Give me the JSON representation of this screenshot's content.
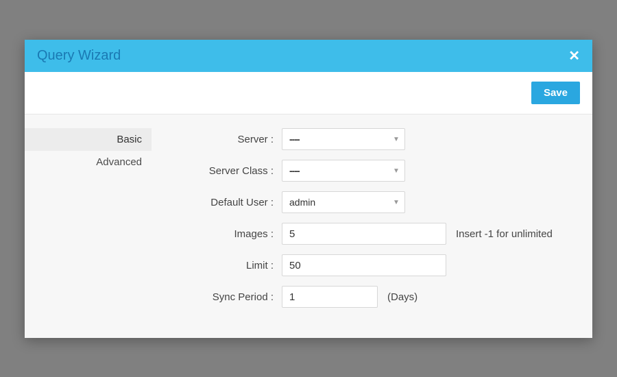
{
  "modal": {
    "title": "Query Wizard"
  },
  "toolbar": {
    "save_label": "Save"
  },
  "sidebar": {
    "items": [
      {
        "label": "Basic",
        "active": true
      },
      {
        "label": "Advanced",
        "active": false
      }
    ]
  },
  "form": {
    "server": {
      "label": "Server :",
      "value": "----"
    },
    "server_class": {
      "label": "Server Class :",
      "value": "----"
    },
    "default_user": {
      "label": "Default User :",
      "value": "admin"
    },
    "images": {
      "label": "Images :",
      "value": "5",
      "hint": "Insert -1 for unlimited"
    },
    "limit": {
      "label": "Limit :",
      "value": "50"
    },
    "sync_period": {
      "label": "Sync Period :",
      "value": "1",
      "hint": "(Days)"
    }
  }
}
